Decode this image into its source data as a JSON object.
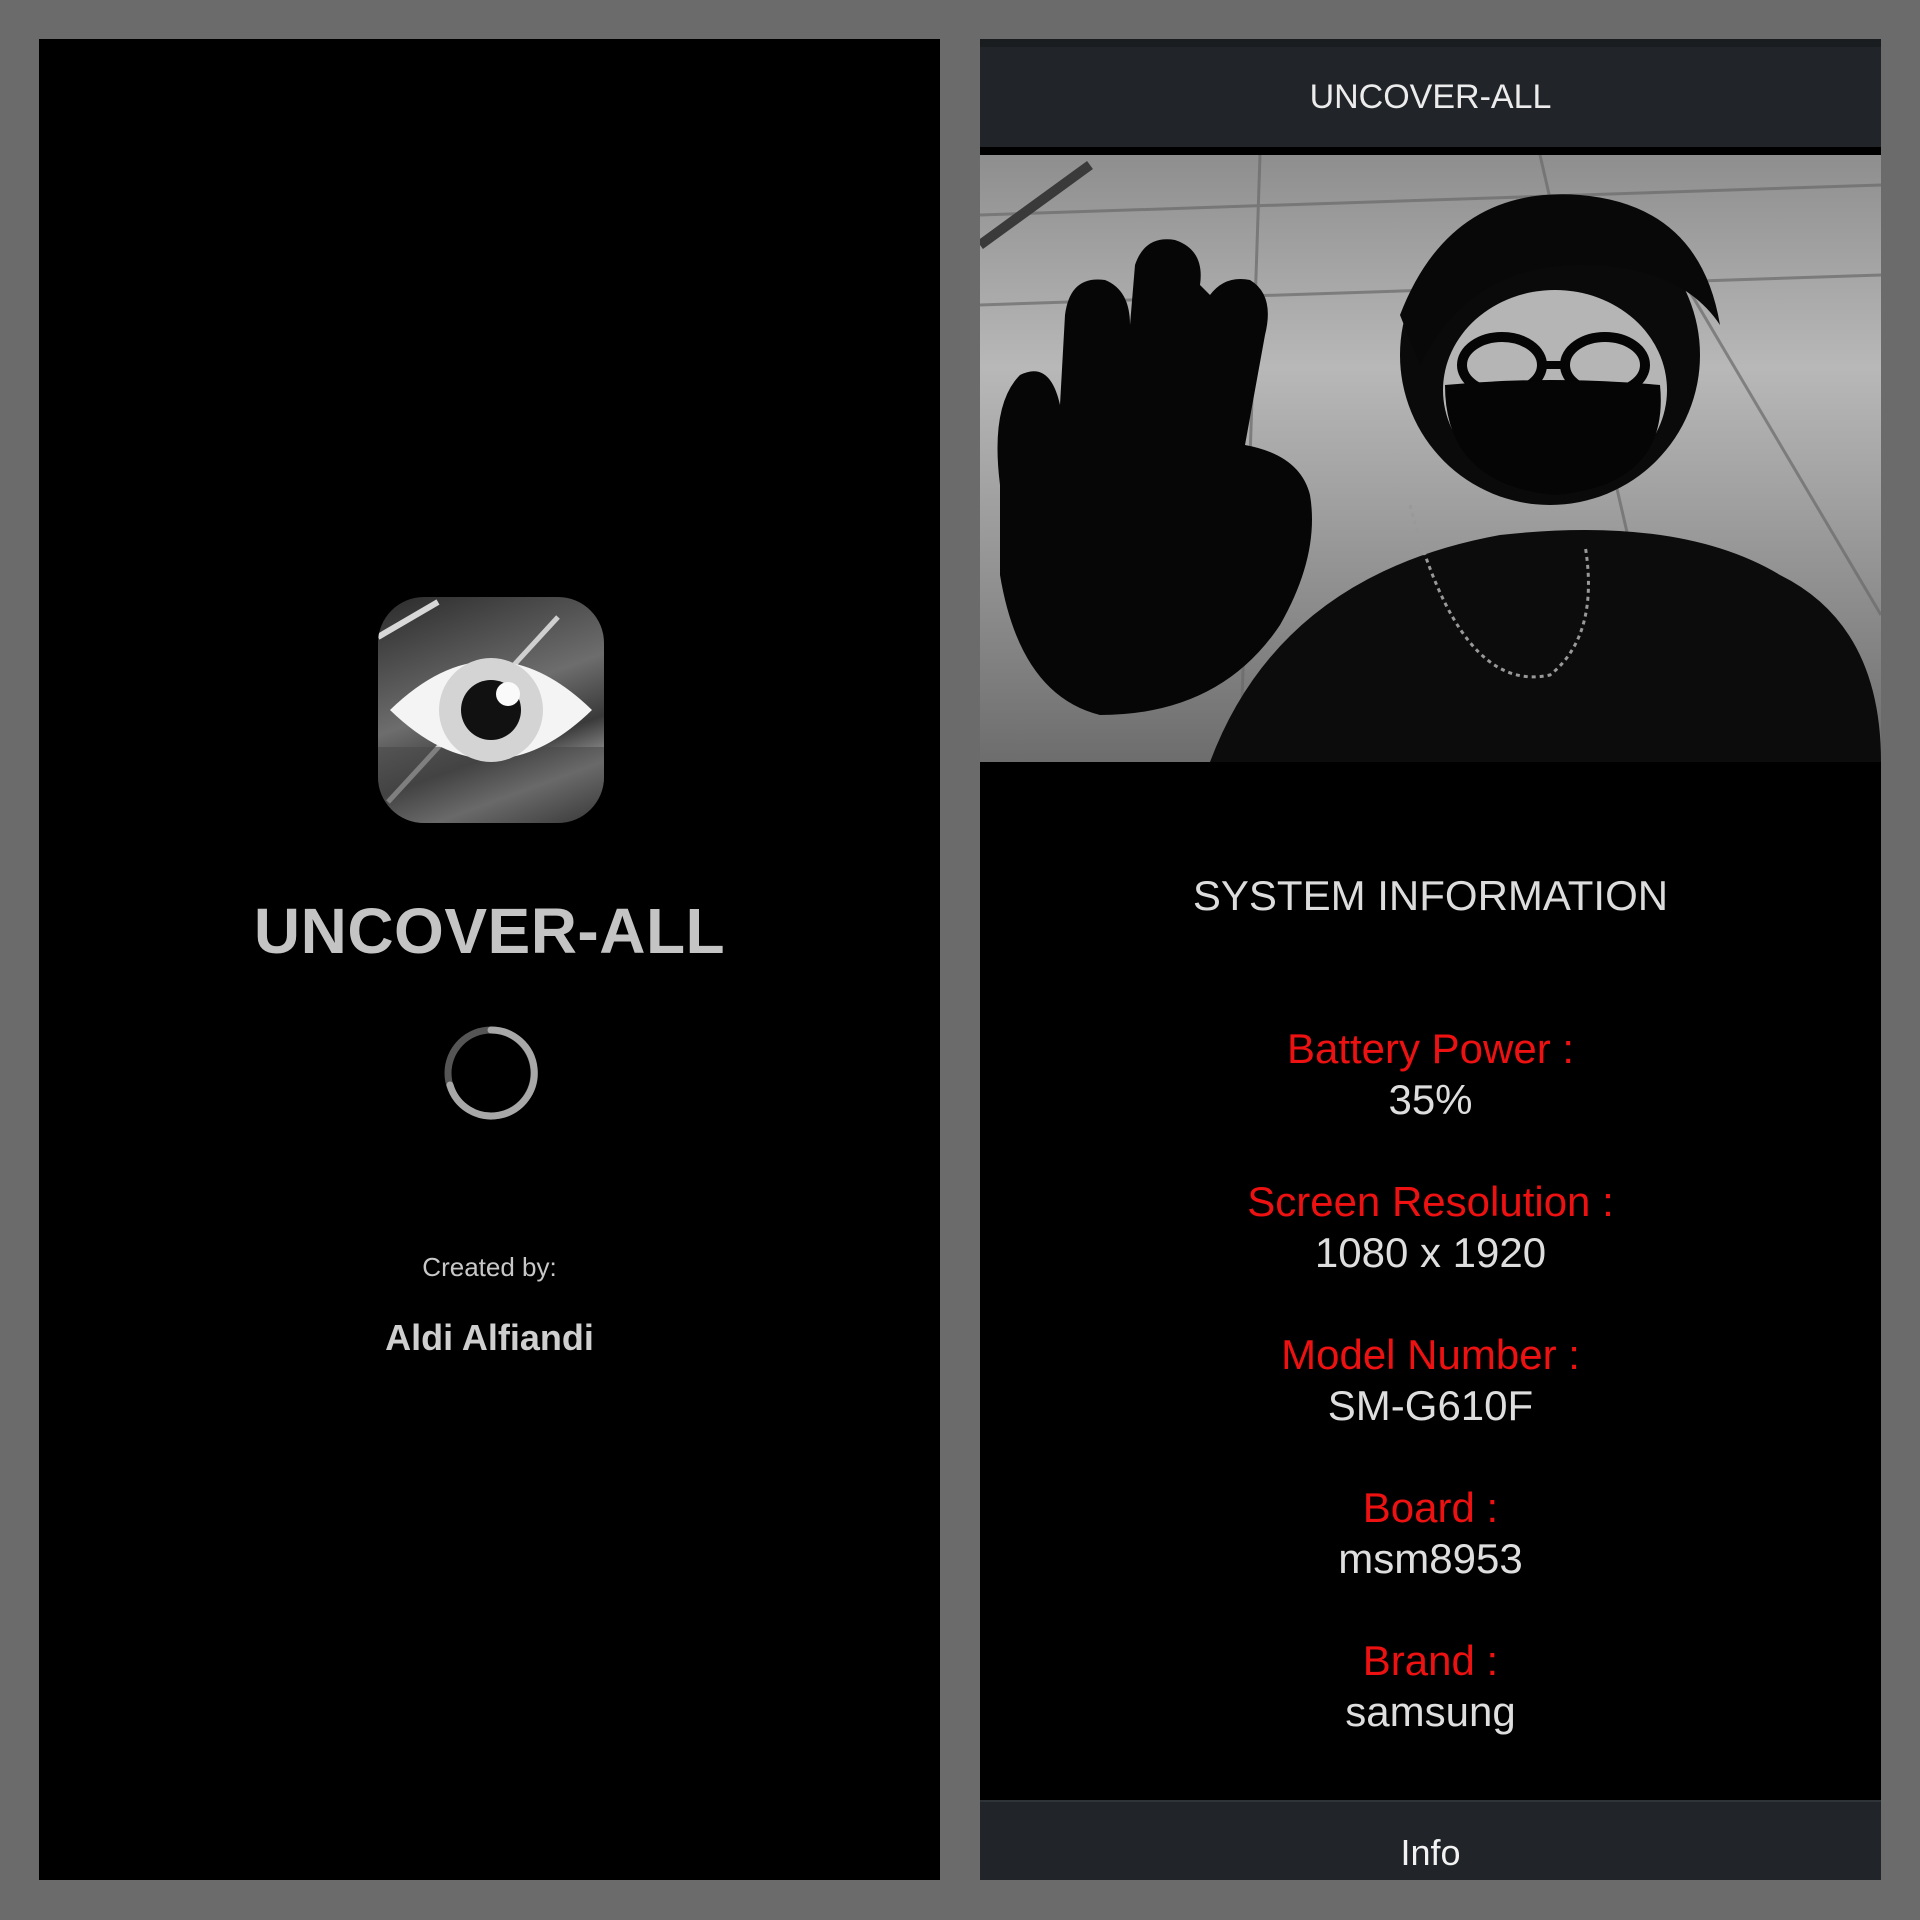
{
  "splash": {
    "app_name": "UNCOVER-ALL",
    "created_label": "Created by:",
    "author": "Aldi Alfiandi",
    "icon": "eye-icon"
  },
  "main": {
    "app_bar_title": "UNCOVER-ALL",
    "section_title": "SYSTEM INFORMATION",
    "items": [
      {
        "label": "Battery Power :",
        "value": "35%"
      },
      {
        "label": "Screen Resolution :",
        "value": "1080 x 1920"
      },
      {
        "label": "Model Number :",
        "value": "SM-G610F"
      },
      {
        "label": "Board :",
        "value": "msm8953"
      },
      {
        "label": "Brand :",
        "value": "samsung"
      }
    ],
    "bottom_nav_label": "Info"
  },
  "colors": {
    "background": "#000000",
    "frame": "#6b6b6b",
    "bar": "#212529",
    "label_red": "#ee1111",
    "text_light": "#dedede"
  }
}
